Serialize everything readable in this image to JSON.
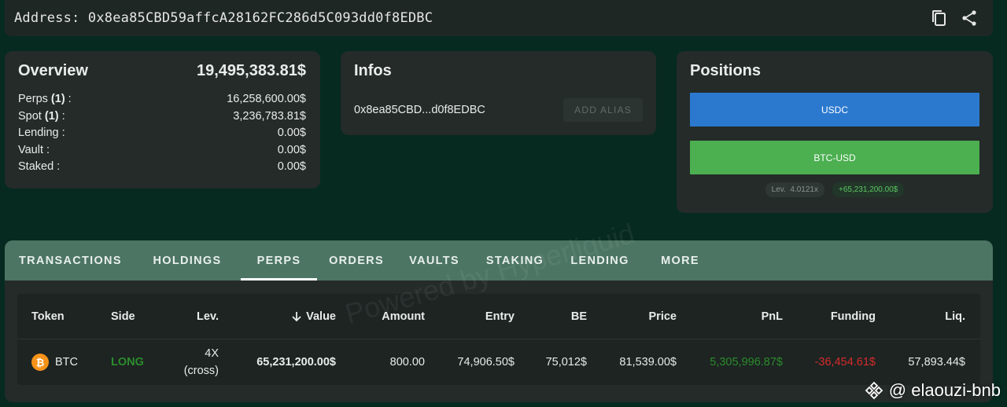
{
  "address_bar": {
    "label": "Address: 0x8ea85CBD59affcA28162FC286d5C093dd0f8EDBC"
  },
  "overview": {
    "title": "Overview",
    "total": "19,495,383.81$",
    "rows": [
      {
        "label": "Perps",
        "count": "(1)",
        "suffix": " :",
        "value": "16,258,600.00$"
      },
      {
        "label": "Spot",
        "count": "(1)",
        "suffix": " :",
        "value": "3,236,783.81$"
      },
      {
        "label": "Lending :",
        "count": "",
        "suffix": "",
        "value": "0.00$"
      },
      {
        "label": "Vault :",
        "count": "",
        "suffix": "",
        "value": "0.00$"
      },
      {
        "label": "Staked :",
        "count": "",
        "suffix": "",
        "value": "0.00$"
      }
    ]
  },
  "infos": {
    "title": "Infos",
    "short_address": "0x8ea85CBD...d0f8EDBC",
    "add_alias": "ADD ALIAS"
  },
  "positions": {
    "title": "Positions",
    "bars": [
      {
        "label": "USDC",
        "color": "#2b79cf"
      },
      {
        "label": "BTC-USD",
        "color": "#4caf50"
      }
    ],
    "lev_label": "Lev.",
    "lev_value": "4.0121x",
    "pnl": "+65,231,200.00$"
  },
  "tabs": [
    "TRANSACTIONS",
    "HOLDINGS",
    "PERPS",
    "ORDERS",
    "VAULTS",
    "STAKING",
    "LENDING",
    "MORE"
  ],
  "active_tab": "PERPS",
  "table": {
    "headers": {
      "token": "Token",
      "side": "Side",
      "lev": "Lev.",
      "value": "Value",
      "amount": "Amount",
      "entry": "Entry",
      "be": "BE",
      "price": "Price",
      "pnl": "PnL",
      "funding": "Funding",
      "liq": "Liq."
    },
    "rows": [
      {
        "token": "BTC",
        "token_icon": "bitcoin-icon",
        "side": "LONG",
        "lev": "4X",
        "lev_mode": "(cross)",
        "value": "65,231,200.00$",
        "amount": "800.00",
        "entry": "74,906.50$",
        "be": "75,012$",
        "price": "81,539.00$",
        "pnl": "5,305,996.87$",
        "funding": "-36,454.61$",
        "liq": "57,893.44$"
      }
    ]
  },
  "watermark": "Powered by Hyperliquid",
  "credit": "@ elaouzi-bnb",
  "colors": {
    "background": "#062a20",
    "card": "#242b29",
    "tab_bar": "#4d7563",
    "long": "#2c8c2c",
    "negative": "#d62b2b",
    "positive_badge": "#5cc460"
  }
}
